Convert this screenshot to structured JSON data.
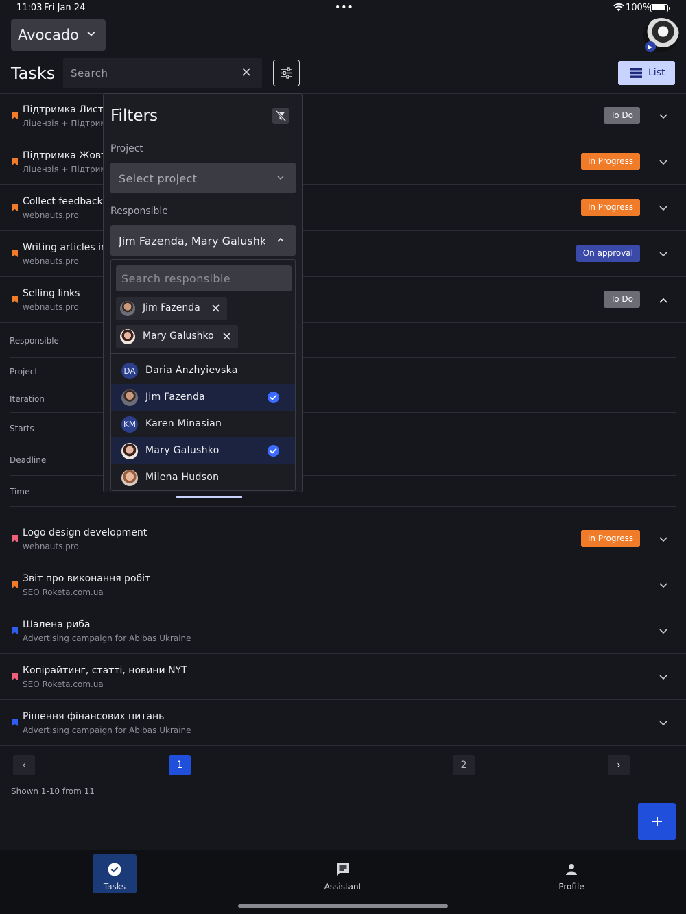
{
  "status_bar": {
    "time": "11:03",
    "date": "Fri Jan 24",
    "battery": "100%"
  },
  "header": {
    "app_name": "Avocado"
  },
  "toolbar": {
    "title": "Tasks",
    "search_placeholder": "Search",
    "view_label": "List"
  },
  "tasks_top": [
    {
      "title": "Підтримка Листопад",
      "subtitle": "Ліцензія + Підтримка",
      "status": "To Do",
      "flag_color": "#f07c2a"
    },
    {
      "title": "Підтримка Жовтень",
      "subtitle": "Ліцензія + Підтримка",
      "status": "In Progress",
      "flag_color": "#f07c2a"
    },
    {
      "title": "Collect feedback",
      "subtitle": "webnauts.pro",
      "status": "In Progress",
      "flag_color": "#f07c2a"
    },
    {
      "title": "Writing articles in",
      "subtitle": "webnauts.pro",
      "status": "On approval",
      "flag_color": "#f07c2a"
    },
    {
      "title": "Selling links",
      "subtitle": "webnauts.pro",
      "status": "To Do",
      "flag_color": "#f07c2a"
    }
  ],
  "task_details": {
    "labels": [
      "Responsible",
      "Project",
      "Iteration",
      "Starts",
      "Deadline",
      "Time"
    ]
  },
  "tasks_bottom": [
    {
      "title": "Logo design development",
      "subtitle": "webnauts.pro",
      "status": "In Progress",
      "flag_color": "#f0607a"
    },
    {
      "title": "Звіт про виконання робіт",
      "subtitle": "SEO Roketa.com.ua",
      "status": "",
      "flag_color": "#f07c2a"
    },
    {
      "title": "Шалена риба",
      "subtitle": "Advertising campaign for Abibas Ukraine",
      "status": "",
      "flag_color": "#2f5df0"
    },
    {
      "title": "Копірайтинг, статті, новини NYT",
      "subtitle": "SEO Roketa.com.ua",
      "status": "",
      "flag_color": "#f0607a"
    },
    {
      "title": "Рішення фінансових питань",
      "subtitle": "Advertising campaign for Abibas Ukraine",
      "status": "",
      "flag_color": "#2f5df0"
    }
  ],
  "status_colors": {
    "To Do": "#6b6c74",
    "In Progress": "#f07c2a",
    "On approval": "#3b49a8"
  },
  "pagination": {
    "prev": "‹",
    "pages": [
      "1",
      "2"
    ],
    "current": "1",
    "next": "›",
    "shown": "Shown 1-10 from 11"
  },
  "filters": {
    "title": "Filters",
    "project_label": "Project",
    "project_placeholder": "Select project",
    "responsible_label": "Responsible",
    "responsible_value": "Jim Fazenda, Mary Galushko",
    "search_placeholder": "Search responsible",
    "selected_chips": [
      "Jim Fazenda",
      "Mary Galushko"
    ],
    "options": [
      {
        "name": "Daria Anzhyievska",
        "initials": "DA",
        "selected": false
      },
      {
        "name": "Jim Fazenda",
        "initials": "",
        "selected": true
      },
      {
        "name": "Karen Minasian",
        "initials": "KM",
        "selected": false
      },
      {
        "name": "Mary Galushko",
        "initials": "",
        "selected": true
      },
      {
        "name": "Milena Hudson",
        "initials": "",
        "selected": false
      }
    ]
  },
  "bottom_nav": {
    "tasks": "Tasks",
    "assistant": "Assistant",
    "profile": "Profile"
  },
  "accent": "#1f4fdb"
}
